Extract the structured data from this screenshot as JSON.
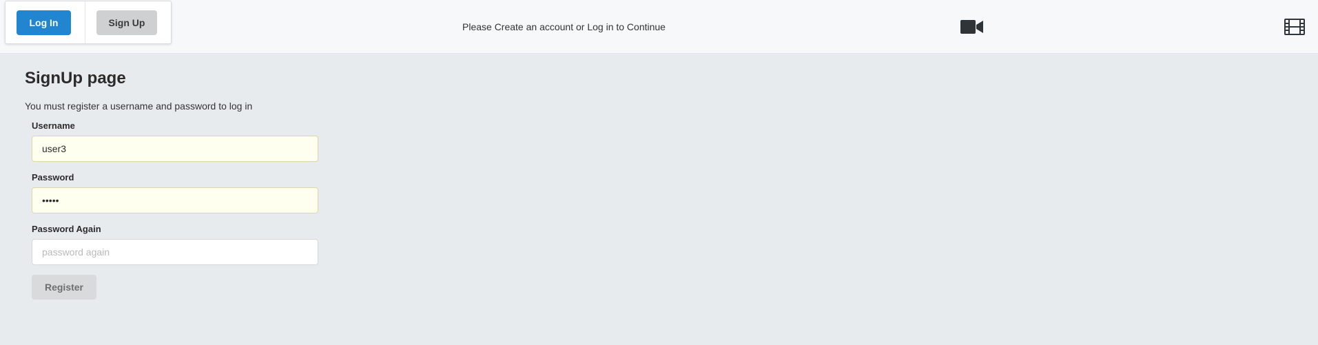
{
  "header": {
    "login_label": "Log In",
    "signup_label": "Sign Up",
    "notice": "Please Create an account or Log in to Continue",
    "icons": [
      "video-camera-icon",
      "film-icon"
    ]
  },
  "page": {
    "title": "SignUp page",
    "description": "You must register a username and password to log in"
  },
  "form": {
    "username": {
      "label": "Username",
      "value": "user3",
      "placeholder": ""
    },
    "password": {
      "label": "Password",
      "value": "•••••",
      "placeholder": ""
    },
    "password_again": {
      "label": "Password Again",
      "value": "",
      "placeholder": "password again"
    },
    "register_label": "Register"
  },
  "colors": {
    "login_button": "#2185d0",
    "signup_button": "#cfd0d2",
    "background": "#e8ebee",
    "autofill_background": "#fffff0"
  }
}
